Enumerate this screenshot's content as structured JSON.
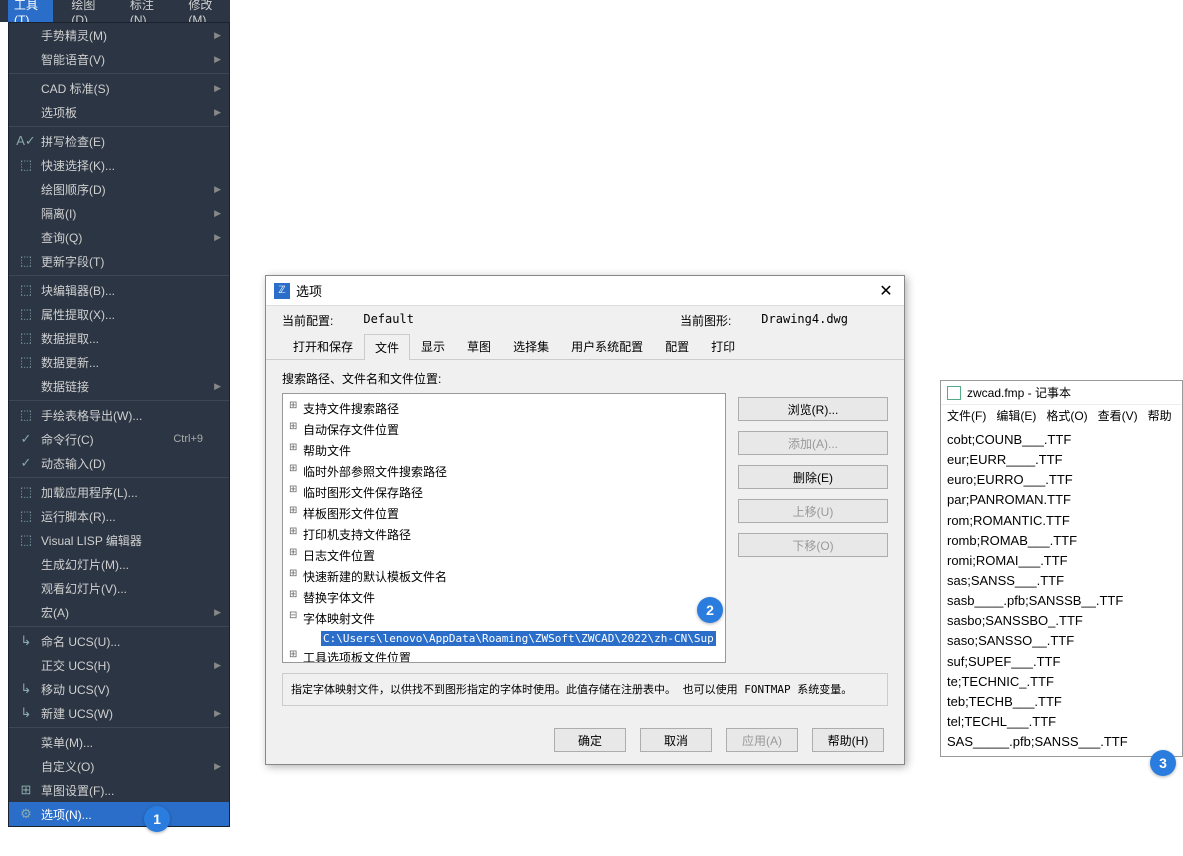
{
  "menubar": {
    "items": [
      "工具(T)",
      "绘图(D)",
      "标注(N)",
      "修改(M)"
    ]
  },
  "dropdown": {
    "items": [
      {
        "label": "手势精灵(M)",
        "icon": "",
        "arrow": true
      },
      {
        "label": "智能语音(V)",
        "icon": "",
        "arrow": true
      },
      {
        "sep": true
      },
      {
        "label": "CAD 标准(S)",
        "icon": "",
        "arrow": true
      },
      {
        "label": "选项板",
        "icon": "",
        "arrow": true
      },
      {
        "sep": true
      },
      {
        "label": "拼写检查(E)",
        "icon": "A✓"
      },
      {
        "label": "快速选择(K)...",
        "icon": "⬚"
      },
      {
        "label": "绘图顺序(D)",
        "icon": "",
        "arrow": true
      },
      {
        "label": "隔离(I)",
        "icon": "",
        "arrow": true
      },
      {
        "label": "查询(Q)",
        "icon": "",
        "arrow": true
      },
      {
        "label": "更新字段(T)",
        "icon": "⬚"
      },
      {
        "sep": true
      },
      {
        "label": "块编辑器(B)...",
        "icon": "⬚"
      },
      {
        "label": "属性提取(X)...",
        "icon": "⬚"
      },
      {
        "label": "数据提取...",
        "icon": "⬚"
      },
      {
        "label": "数据更新...",
        "icon": "⬚"
      },
      {
        "label": "数据链接",
        "icon": "",
        "arrow": true
      },
      {
        "sep": true
      },
      {
        "label": "手绘表格导出(W)...",
        "icon": "⬚"
      },
      {
        "label": "命令行(C)",
        "icon": "✓",
        "shortcut": "Ctrl+9"
      },
      {
        "label": "动态输入(D)",
        "icon": "✓"
      },
      {
        "sep": true
      },
      {
        "label": "加载应用程序(L)...",
        "icon": "⬚"
      },
      {
        "label": "运行脚本(R)...",
        "icon": "⬚"
      },
      {
        "label": "Visual LISP 编辑器",
        "icon": "⬚"
      },
      {
        "label": "生成幻灯片(M)...",
        "icon": ""
      },
      {
        "label": "观看幻灯片(V)...",
        "icon": ""
      },
      {
        "label": "宏(A)",
        "icon": "",
        "arrow": true
      },
      {
        "sep": true
      },
      {
        "label": "命名 UCS(U)...",
        "icon": "↳"
      },
      {
        "label": "正交 UCS(H)",
        "icon": "",
        "arrow": true
      },
      {
        "label": "移动 UCS(V)",
        "icon": "↳"
      },
      {
        "label": "新建 UCS(W)",
        "icon": "↳",
        "arrow": true
      },
      {
        "sep": true
      },
      {
        "label": "菜单(M)...",
        "icon": ""
      },
      {
        "label": "自定义(O)",
        "icon": "",
        "arrow": true
      },
      {
        "label": "草图设置(F)...",
        "icon": "⊞"
      },
      {
        "label": "选项(N)...",
        "icon": "⚙",
        "selected": true
      }
    ]
  },
  "dialog": {
    "title": "选项",
    "current_config_label": "当前配置:",
    "current_config_value": "Default",
    "current_drawing_label": "当前图形:",
    "current_drawing_value": "Drawing4.dwg",
    "tabs": [
      "打开和保存",
      "文件",
      "显示",
      "草图",
      "选择集",
      "用户系统配置",
      "配置",
      "打印"
    ],
    "active_tab": 1,
    "section_label": "搜索路径、文件名和文件位置:",
    "tree": [
      {
        "label": "支持文件搜索路径"
      },
      {
        "label": "自动保存文件位置"
      },
      {
        "label": "帮助文件"
      },
      {
        "label": "临时外部参照文件搜索路径"
      },
      {
        "label": "临时图形文件保存路径"
      },
      {
        "label": "样板图形文件位置"
      },
      {
        "label": "打印机支持文件路径"
      },
      {
        "label": "日志文件位置"
      },
      {
        "label": "快速新建的默认模板文件名"
      },
      {
        "label": "替换字体文件"
      },
      {
        "label": "字体映射文件",
        "open": true
      },
      {
        "label": "C:\\Users\\lenovo\\AppData\\Roaming\\ZWSoft\\ZWCAD\\2022\\zh-CN\\Sup",
        "leaf": true,
        "selected": true,
        "indent": true
      },
      {
        "label": "工具选项板文件位置"
      }
    ],
    "buttons": {
      "browse": "浏览(R)...",
      "add": "添加(A)...",
      "delete": "删除(E)",
      "moveup": "上移(U)",
      "movedown": "下移(O)"
    },
    "desc": "指定字体映射文件，以供找不到图形指定的字体时使用。此值存储在注册表中。\n也可以使用 FONTMAP 系统变量。",
    "footer": {
      "ok": "确定",
      "cancel": "取消",
      "apply": "应用(A)",
      "help": "帮助(H)"
    }
  },
  "notepad": {
    "title": "zwcad.fmp - 记事本",
    "menus": [
      "文件(F)",
      "编辑(E)",
      "格式(O)",
      "查看(V)",
      "帮助"
    ],
    "lines": [
      "cobt;COUNB___.TTF",
      "eur;EURR____.TTF",
      "euro;EURRO___.TTF",
      "par;PANROMAN.TTF",
      "rom;ROMANTIC.TTF",
      "romb;ROMAB___.TTF",
      "romi;ROMAI___.TTF",
      "sas;SANSS___.TTF",
      "sasb____.pfb;SANSSB__.TTF",
      "sasbo;SANSSBO_.TTF",
      "saso;SANSSO__.TTF",
      "suf;SUPEF___.TTF",
      "te;TECHNIC_.TTF",
      "teb;TECHB___.TTF",
      "tel;TECHL___.TTF",
      "SAS_____.pfb;SANSS___.TTF"
    ]
  },
  "callouts": {
    "c1": "1",
    "c2": "2",
    "c3": "3"
  }
}
